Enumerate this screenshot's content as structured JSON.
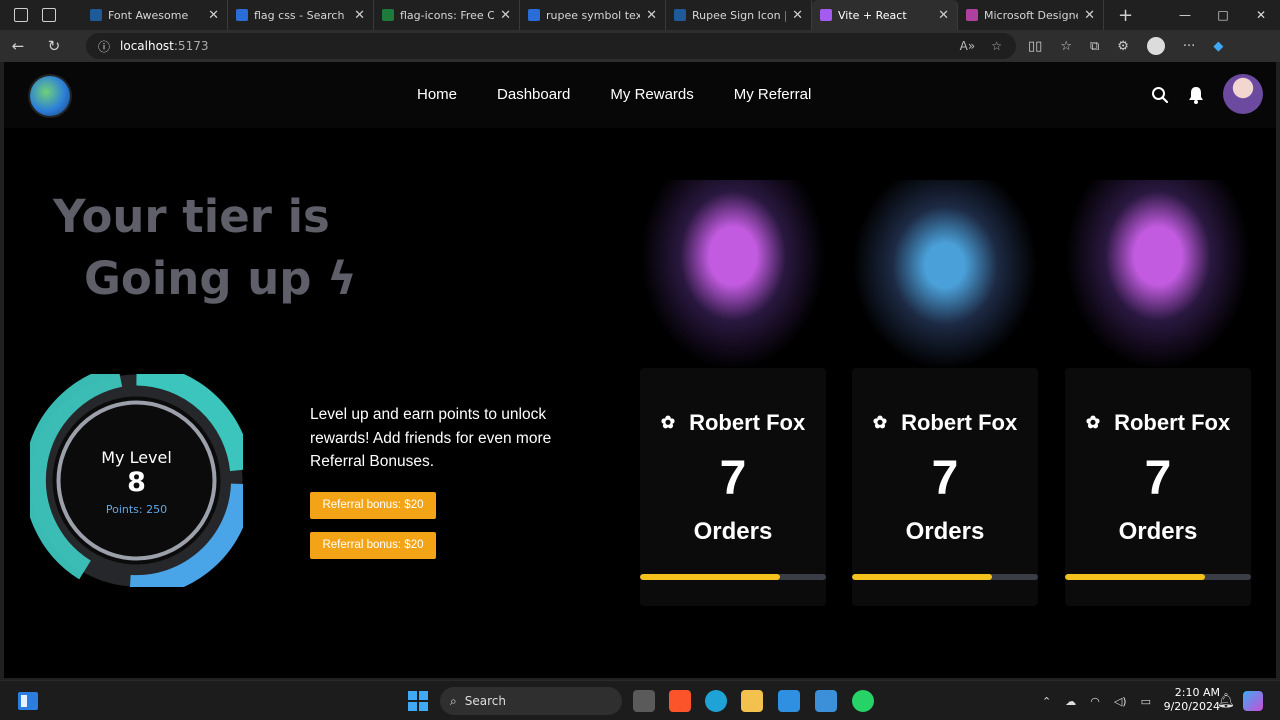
{
  "browser": {
    "tabs": [
      {
        "title": "Font Awesome",
        "color": "#1e5a99"
      },
      {
        "title": "flag css - Search",
        "color": "#2a6dd9"
      },
      {
        "title": "flag-icons: Free Coun",
        "color": "#1d7a3a"
      },
      {
        "title": "rupee symbol text - S",
        "color": "#2a6dd9"
      },
      {
        "title": "Rupee Sign Icon | For",
        "color": "#1e5a99"
      },
      {
        "title": "Vite + React",
        "color": "#a45cf0",
        "active": true
      },
      {
        "title": "Microsoft Designer -",
        "color": "#b040a0"
      }
    ],
    "url_host": "localhost",
    "url_port": ":5173"
  },
  "nav": {
    "items": [
      "Home",
      "Dashboard",
      "My Rewards",
      "My Referral"
    ]
  },
  "hero": {
    "line1": "Your tier is",
    "line2": "Going up ϟ"
  },
  "level": {
    "title": "My Level",
    "value": "8",
    "points": "Points: 250"
  },
  "description": "Level up and earn points to unlock rewards! Add friends for even more Referral Bonuses.",
  "buttons": [
    "Referral bonus: $20",
    "Referral bonus: $20"
  ],
  "cards": [
    {
      "name": "Robert Fox",
      "count": "7",
      "unit": "Orders",
      "progress": 0.75
    },
    {
      "name": "Robert Fox",
      "count": "7",
      "unit": "Orders",
      "progress": 0.75
    },
    {
      "name": "Robert Fox",
      "count": "7",
      "unit": "Orders",
      "progress": 0.75
    }
  ],
  "taskbar": {
    "search": "Search",
    "time": "2:10 AM",
    "date": "9/20/2024"
  }
}
